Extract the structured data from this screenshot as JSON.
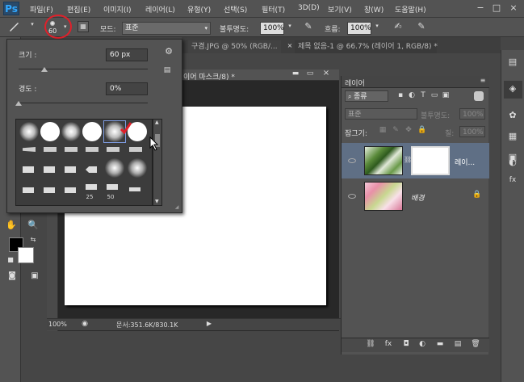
{
  "app": {
    "logo": "Ps"
  },
  "menu": [
    "파일(F)",
    "편집(E)",
    "이미지(I)",
    "레이어(L)",
    "유형(Y)",
    "선택(S)",
    "필터(T)",
    "3D(D)",
    "보기(V)",
    "창(W)",
    "도움말(H)"
  ],
  "window_controls": {
    "minimize": "−",
    "maximize": "□",
    "close": "×"
  },
  "options": {
    "brush_size": "60",
    "mode_label": "모드:",
    "mode_value": "표준",
    "opacity_label": "불투명도:",
    "opacity_value": "100%",
    "flow_label": "흐름:",
    "flow_value": "100%"
  },
  "tabs": [
    {
      "label": "구겸.JPG @ 50% (RGB/..."
    },
    {
      "label": "제목 없음-1 @ 66.7% (레이어 1, RGB/8) *"
    }
  ],
  "doc_tab_title": "이어 마스크/8) *",
  "brush_picker": {
    "size_label": "크기 :",
    "size_value": "60 px",
    "hardness_label": "경도 :",
    "hardness_value": "0%",
    "size_level": 0.2,
    "hardness_level": 0.0,
    "tip_labels": [
      "25",
      "50"
    ]
  },
  "status": {
    "zoom": "100%",
    "doc_info": "문서:351.6K/830.1K"
  },
  "layers": {
    "panel_title": "레이어",
    "filter_kind": "종류",
    "blend_mode": "표준",
    "opacity_label": "불투명도:",
    "opacity_value": "100%",
    "lock_label": "잠그기:",
    "fill_label": "칠:",
    "fill_value": "100%",
    "items": [
      {
        "name": "레이..."
      },
      {
        "name": "배경"
      }
    ]
  },
  "colors": {
    "foreground": "#000000",
    "background": "#ffffff",
    "highlight": "#e0202a"
  }
}
